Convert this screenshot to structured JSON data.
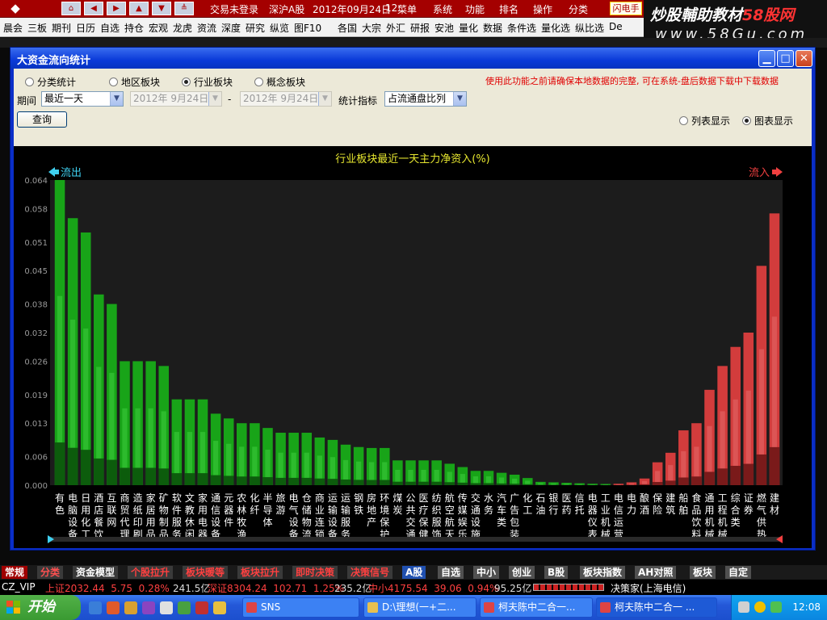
{
  "top": {
    "login": "交易未登录",
    "market": "深沪A股",
    "date": "2012年09月24日",
    "time": "12:",
    "menu_label": "菜单",
    "sys_items": [
      "系统",
      "功能",
      "排名",
      "操作",
      "分类"
    ],
    "flash": "闪电手"
  },
  "watermark": {
    "brand": "炒股輔助教材",
    "brand_red": "58股网",
    "url": "www.58Gu.com"
  },
  "menu": [
    "晨会",
    "三板",
    "期刊",
    "日历",
    "自选",
    "持仓",
    "宏观",
    "龙虎",
    "资流",
    "深度",
    "研究",
    "纵览",
    "图F10",
    "各国",
    "大宗",
    "外汇",
    "研报",
    "安池",
    "量化",
    "数据",
    "条件选",
    "量化选",
    "纵比选",
    "De"
  ],
  "window": {
    "title": "大资金流向统计",
    "radios": [
      {
        "label": "分类统计",
        "on": false
      },
      {
        "label": "地区板块",
        "on": false
      },
      {
        "label": "行业板块",
        "on": true
      },
      {
        "label": "概念板块",
        "on": false
      }
    ],
    "notice": "使用此功能之前请确保本地数据的完整, 可在系统-盘后数据下载中下载数据",
    "period_label": "期间",
    "period_value": "最近一天",
    "date_from": "2012年 9月24日",
    "date_sep": "-",
    "date_to": "2012年 9月24日",
    "metric_label": "统计指标",
    "metric_value": "占流通盘比列",
    "query_button": "查询",
    "view_list": "列表显示",
    "view_chart": "图表显示",
    "view_chart_selected": true
  },
  "chart_data": {
    "type": "bar",
    "title": "行业板块最近一天主力净资入(%)",
    "left_label": "流出",
    "right_label": "流入",
    "ylim": [
      0,
      0.064
    ],
    "yticks": [
      "0.000",
      "0.006",
      "0.013",
      "0.019",
      "0.026",
      "0.032",
      "0.038",
      "0.045",
      "0.051",
      "0.058",
      "0.064"
    ],
    "colors": {
      "out": "#18a418",
      "in": "#d23c3c"
    },
    "categories": [
      "有色",
      "电脑设备",
      "日用化工",
      "酒店餐饮",
      "互联网",
      "商贸代理",
      "造纸印刷",
      "家居用品",
      "矿物制品",
      "软件服务",
      "文教休闲",
      "家用电器",
      "通信设备",
      "元器件",
      "农林牧渔",
      "化纤",
      "半导体",
      "旅游",
      "电气设备",
      "仓储物流",
      "商业连锁",
      "运输设备",
      "运输服务",
      "钢铁",
      "房地产",
      "环境保护",
      "煤炭",
      "公共交通",
      "医疗保健",
      "纺织服饰",
      "航空航天",
      "传媒娱乐",
      "交通设施",
      "水务",
      "汽车类",
      "广告包装",
      "化工",
      "石油",
      "银行",
      "医药",
      "信托",
      "电器仪表",
      "工业机械",
      "电信运营",
      "电力",
      "酿酒",
      "保险",
      "建筑",
      "船舶",
      "食品饮料",
      "通用机械",
      "工程机械",
      "综合类",
      "证券",
      "燃气供热",
      "建材"
    ],
    "series": [
      {
        "flow": "out",
        "values": [
          0.064,
          0.056,
          0.053,
          0.04,
          0.038,
          0.026,
          0.026,
          0.026,
          0.025,
          0.018,
          0.018,
          0.018,
          0.015,
          0.014,
          0.013,
          0.013,
          0.012,
          0.011,
          0.011,
          0.011,
          0.01,
          0.0095,
          0.0085,
          0.008,
          0.0078,
          0.0078,
          0.0052,
          0.0052,
          0.0052,
          0.0052,
          0.0045,
          0.0038,
          0.003,
          0.003,
          0.0026,
          0.0022,
          0.0015,
          0.0007,
          0.0006,
          0.0005,
          0.0004,
          0.0003,
          0.0002,
          0,
          0,
          0,
          0,
          0,
          0,
          0,
          0,
          0,
          0,
          0,
          0,
          0
        ]
      },
      {
        "flow": "in",
        "values": [
          0,
          0,
          0,
          0,
          0,
          0,
          0,
          0,
          0,
          0,
          0,
          0,
          0,
          0,
          0,
          0,
          0,
          0,
          0,
          0,
          0,
          0,
          0,
          0,
          0,
          0,
          0,
          0,
          0,
          0,
          0,
          0,
          0,
          0,
          0,
          0,
          0,
          0,
          0,
          0,
          0,
          0,
          0,
          0.0003,
          0.0006,
          0.0014,
          0.0048,
          0.0068,
          0.0115,
          0.013,
          0.02,
          0.025,
          0.029,
          0.032,
          0.046,
          0.057
        ]
      }
    ]
  },
  "bottom_tabs": [
    "常规",
    "分类",
    "资金模型",
    "个股拉升",
    "板块暖等",
    "板块拉升",
    "即时决策",
    "决策信号",
    "A股",
    "自选",
    "中小",
    "创业",
    "B股",
    "板块指数",
    "AH对照",
    "板块",
    "自定"
  ],
  "status": {
    "vip": "CZ_VIP",
    "sh_name": "上证",
    "sh_index": "2032.44",
    "sh_chg": "5.75",
    "sh_pct": "0.28%",
    "sh_vol": "241.5亿",
    "sz_name": "深证",
    "sz_index": "8304.24",
    "sz_chg": "102.71",
    "sz_pct": "1.25%",
    "sz_vol": "235.2亿",
    "zx_name": "中小",
    "zx_index": "4175.54",
    "zx_chg": "39.06",
    "zx_pct": "0.94%",
    "zx_vol": "95.25亿",
    "server": "决策家(上海电信)"
  },
  "taskbar": {
    "start": "开始",
    "tasks": [
      "SNS",
      "D:\\理想(一+二...",
      "柯夫陈中二合一...",
      "柯夫陈中二合一 ..."
    ],
    "clock": "12:08"
  }
}
